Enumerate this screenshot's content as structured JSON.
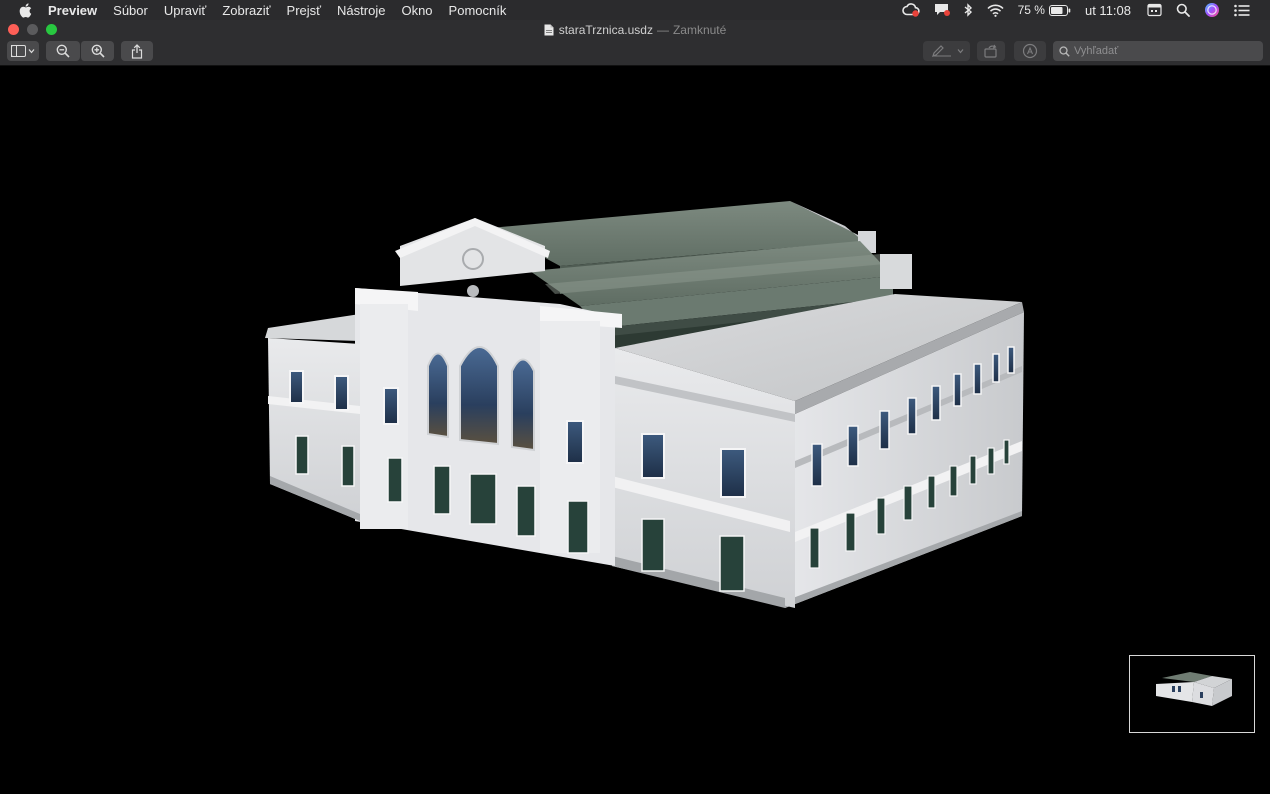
{
  "menubar": {
    "app_name": "Preview",
    "items": [
      "Súbor",
      "Upraviť",
      "Zobraziť",
      "Prejsť",
      "Nástroje",
      "Okno",
      "Pomocník"
    ],
    "status": {
      "battery": "75 %",
      "clock": "ut 11:08"
    }
  },
  "window": {
    "filename": "staraTrznica.usdz",
    "separator": "—",
    "status": "Zamknuté"
  },
  "toolbar": {
    "search_placeholder": "Vyhľadať"
  },
  "colors": {
    "menubar_bg": "#2b2b2d",
    "toolbar_bg": "#2e2e30",
    "viewport_bg": "#000000",
    "close": "#fe5f57",
    "maximize": "#28c840"
  },
  "icons": [
    "apple-icon",
    "creative-cloud-icon",
    "notification-icon",
    "bluetooth-icon",
    "wifi-icon",
    "battery-icon",
    "calendar-icon",
    "spotlight-search-icon",
    "siri-icon",
    "control-center-icon",
    "document-icon",
    "sidebar-icon",
    "zoom-out-icon",
    "zoom-in-icon",
    "share-icon",
    "markup-icon",
    "rotate-icon",
    "annotate-icon"
  ]
}
